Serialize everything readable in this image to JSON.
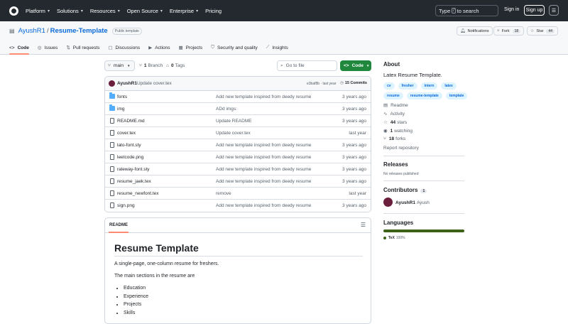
{
  "header": {
    "nav": [
      {
        "label": "Platform",
        "has_menu": true
      },
      {
        "label": "Solutions",
        "has_menu": true
      },
      {
        "label": "Resources",
        "has_menu": true
      },
      {
        "label": "Open Source",
        "has_menu": true
      },
      {
        "label": "Enterprise",
        "has_menu": true
      },
      {
        "label": "Pricing",
        "has_menu": false
      }
    ],
    "search_pre": "Type",
    "search_key": "/",
    "search_post": "to search",
    "signin": "Sign in",
    "signup": "Sign up",
    "menu_glyph": "☰"
  },
  "repo": {
    "owner": "AyushR1",
    "separator": "/",
    "name": "Resume-Template",
    "visibility": "Public template",
    "notifications": "Notifications",
    "fork_label": "Fork",
    "fork_count": "18",
    "star_label": "Star",
    "star_count": "44"
  },
  "tabs": [
    {
      "label": "Code",
      "icon": "code-icon",
      "glyph": "<>"
    },
    {
      "label": "Issues",
      "icon": "issue-icon",
      "glyph": "◎"
    },
    {
      "label": "Pull requests",
      "icon": "pull-request-icon",
      "glyph": "⇅"
    },
    {
      "label": "Discussions",
      "icon": "discussion-icon",
      "glyph": "▢"
    },
    {
      "label": "Actions",
      "icon": "play-icon",
      "glyph": "▶"
    },
    {
      "label": "Projects",
      "icon": "table-icon",
      "glyph": "▦"
    },
    {
      "label": "Security and quality",
      "icon": "shield-icon",
      "glyph": "⛉"
    },
    {
      "label": "Insights",
      "icon": "graph-icon",
      "glyph": "⟋"
    }
  ],
  "branch": {
    "name": "main",
    "branches_count": "1",
    "branches_label": "Branch",
    "tags_count": "0",
    "tags_label": "Tags",
    "go_to_file": "Go to file",
    "code_button": "Code"
  },
  "latest_commit": {
    "author": "AyushR1",
    "message": "Update cover.tex",
    "meta": "e3baf8b · last year",
    "commits_count": "15 Commits"
  },
  "files": [
    {
      "type": "folder",
      "name": "fonts",
      "message": "Add new template inspired from deedy resume",
      "time": "3 years ago"
    },
    {
      "type": "folder",
      "name": "img",
      "message": "ADd imgs:",
      "time": "3 years ago"
    },
    {
      "type": "file",
      "name": "README.md",
      "message": "Update README",
      "time": "3 years ago"
    },
    {
      "type": "file",
      "name": "cover.tex",
      "message": "Update cover.tex",
      "time": "last year"
    },
    {
      "type": "file",
      "name": "lato-font.sty",
      "message": "Add new template inspired from deedy resume",
      "time": "3 years ago"
    },
    {
      "type": "file",
      "name": "leetcode.png",
      "message": "Add new template inspired from deedy resume",
      "time": "3 years ago"
    },
    {
      "type": "file",
      "name": "raleway-font.sty",
      "message": "Add new template inspired from deedy resume",
      "time": "3 years ago"
    },
    {
      "type": "file",
      "name": "resume_jaek.tex",
      "message": "Add new template inspired from deedy resume",
      "time": "3 years ago"
    },
    {
      "type": "file",
      "name": "resume_newfont.tex",
      "message": "remove",
      "time": "last year"
    },
    {
      "type": "file",
      "name": "sign.png",
      "message": "Add new template inspired from deedy resume",
      "time": "3 years ago"
    }
  ],
  "readme": {
    "tab_label": "README",
    "title": "Resume Template",
    "intro": "A single-page, one-column resume for freshers.",
    "sections_intro": "The main sections in the resume are",
    "sections": [
      "Education",
      "Experience",
      "Projects",
      "Skills"
    ]
  },
  "about": {
    "heading": "About",
    "description": "Latex Resume Template.",
    "topics": [
      "cv",
      "fresher",
      "intern",
      "latex",
      "resume",
      "resume-template",
      "template"
    ],
    "readme_link": "Readme",
    "activity_link": "Activity",
    "stars_count": "44",
    "stars_label": "stars",
    "watching_count": "1",
    "watching_label": "watching",
    "forks_count": "18",
    "forks_label": "forks",
    "report": "Report repository"
  },
  "releases": {
    "heading": "Releases",
    "empty": "No releases published"
  },
  "contributors": {
    "heading": "Contributors",
    "count": "1",
    "login": "AyushR1",
    "name": "Ayush"
  },
  "languages": {
    "heading": "Languages",
    "items": [
      {
        "name": "TeX",
        "percent": "100%",
        "color": "#3D6117",
        "share": 100
      }
    ]
  },
  "colors": {
    "header_bg": "#24292f",
    "link": "#0969da",
    "primary_button": "#1f883d",
    "active_tab_underline": "#fd8c73",
    "folder": "#54aeff"
  }
}
